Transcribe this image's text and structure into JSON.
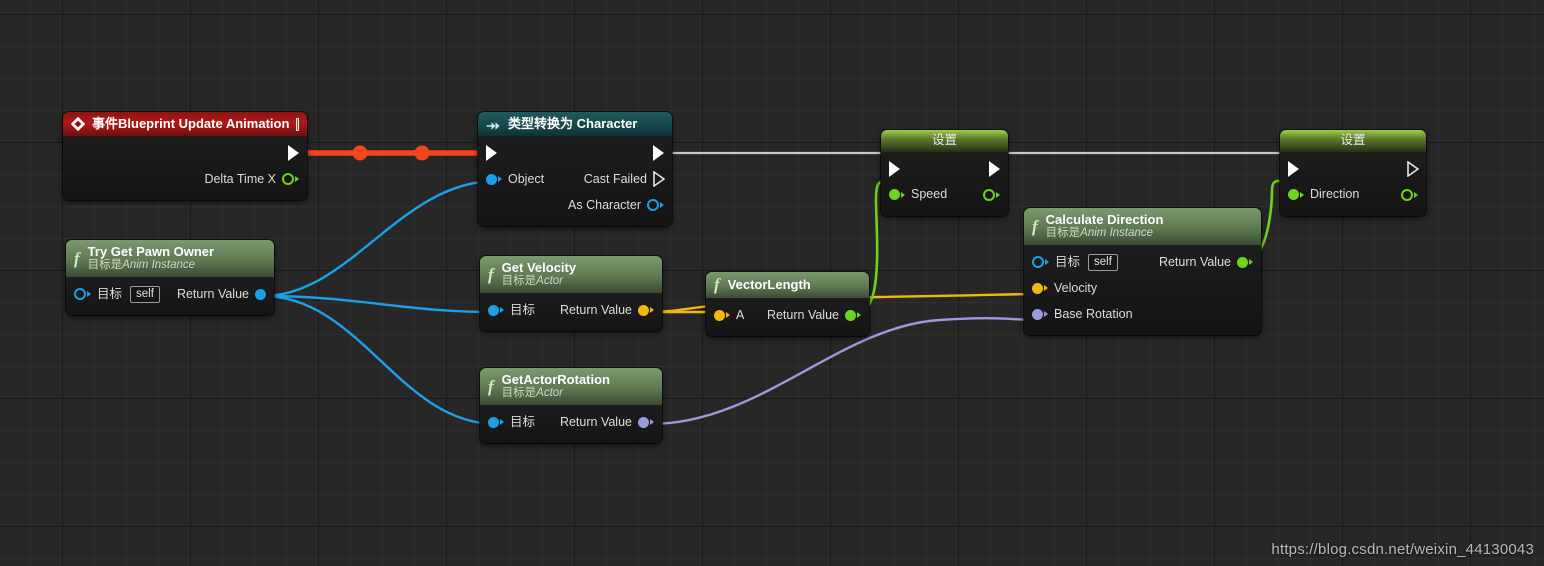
{
  "watermark": "https://blog.csdn.net/weixin_44130043",
  "colors": {
    "exec_active_wire": "#f2441d",
    "exec_wire": "#c8c8c8",
    "object_wire": "#1ba0e8",
    "vector_wire": "#f0b90b",
    "float_wire": "#6dd420",
    "rotator_wire": "#9a9ade",
    "event_title": "#b01a16",
    "cast_title": "#17494c",
    "function_title": "#5d7a52",
    "set_title": "#5c7a2c",
    "canvas": "#272727"
  },
  "nodes": {
    "event_update_animation": {
      "title": "事件Blueprint Update Animation",
      "icon": "event-diamond-icon",
      "badge": "red-stop-square-icon",
      "out_exec": "",
      "out_pin_label": "Delta Time X"
    },
    "try_get_pawn_owner": {
      "title": "Try Get Pawn Owner",
      "subtitle_prefix": "目标是",
      "subtitle": "Anim Instance",
      "in_pin_label": "目标",
      "in_pin_value": "self",
      "out_pin_label": "Return Value"
    },
    "cast_to_character": {
      "title": "类型转换为 Character",
      "icon": "cast-arrow-icon",
      "in_pin_label": "Object",
      "out_failed_label": "Cast Failed",
      "out_as_label": "As Character"
    },
    "get_velocity": {
      "title": "Get Velocity",
      "subtitle_prefix": "目标是",
      "subtitle": "Actor",
      "in_pin_label": "目标",
      "out_pin_label": "Return Value"
    },
    "get_actor_rotation": {
      "title": "GetActorRotation",
      "subtitle_prefix": "目标是",
      "subtitle": "Actor",
      "in_pin_label": "目标",
      "out_pin_label": "Return Value"
    },
    "vector_length": {
      "title": "VectorLength",
      "in_pin_label": "A",
      "out_pin_label": "Return Value"
    },
    "set_speed": {
      "title": "设置",
      "in_pin_label": "Speed"
    },
    "set_direction": {
      "title": "设置",
      "in_pin_label": "Direction"
    },
    "calculate_direction": {
      "title": "Calculate Direction",
      "subtitle_prefix": "目标是",
      "subtitle": "Anim Instance",
      "in_pin_target": "目标",
      "in_pin_target_value": "self",
      "in_pin_velocity": "Velocity",
      "in_pin_base_rotation": "Base Rotation",
      "out_pin_label": "Return Value"
    }
  }
}
